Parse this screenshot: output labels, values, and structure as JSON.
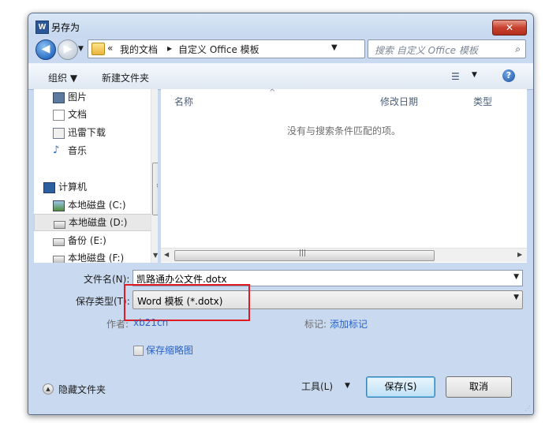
{
  "window": {
    "title": "另存为",
    "app_icon_text": "W",
    "close_symbol": "✕"
  },
  "address": {
    "overflow": "«",
    "crumbs": [
      "我的文档",
      "自定义 Office 模板"
    ],
    "separator": "▸"
  },
  "search": {
    "placeholder": "搜索 自定义 Office 模板"
  },
  "toolbar": {
    "organize_label": "组织 ▼",
    "new_folder_label": "新建文件夹"
  },
  "nav": {
    "items": [
      {
        "label": "图片",
        "icon": "pictures-icon"
      },
      {
        "label": "文档",
        "icon": "documents-icon"
      },
      {
        "label": "迅雷下载",
        "icon": "downloads-icon"
      },
      {
        "label": "音乐",
        "icon": "music-icon"
      },
      {
        "label": "计算机",
        "icon": "computer-icon"
      },
      {
        "label": "本地磁盘 (C:)",
        "icon": "system-drive-icon"
      },
      {
        "label": "本地磁盘 (D:)",
        "icon": "drive-icon"
      },
      {
        "label": "备份 (E:)",
        "icon": "drive-icon"
      },
      {
        "label": "本地磁盘 (F:)",
        "icon": "drive-icon"
      }
    ],
    "selected_index": 6
  },
  "files": {
    "columns": [
      "名称",
      "修改日期",
      "类型"
    ],
    "empty_message": "没有与搜索条件匹配的项。"
  },
  "form": {
    "filename_label": "文件名(N):",
    "filename_value": "凯路通办公文件.dotx",
    "type_label": "保存类型(T):",
    "type_value": "Word 模板 (*.dotx)",
    "author_label": "作者:",
    "author_value": "xb21cn",
    "tags_label": "标记:",
    "tags_value": "添加标记",
    "thumbnail_label": "保存缩略图"
  },
  "footer": {
    "hide_folders_label": "隐藏文件夹",
    "tools_label": "工具(L)",
    "save_label": "保存(S)",
    "cancel_label": "取消"
  },
  "colors": {
    "highlight_border": "#e01b24",
    "link_blue": "#2a62c7",
    "window_frame": "#c9daf0"
  }
}
